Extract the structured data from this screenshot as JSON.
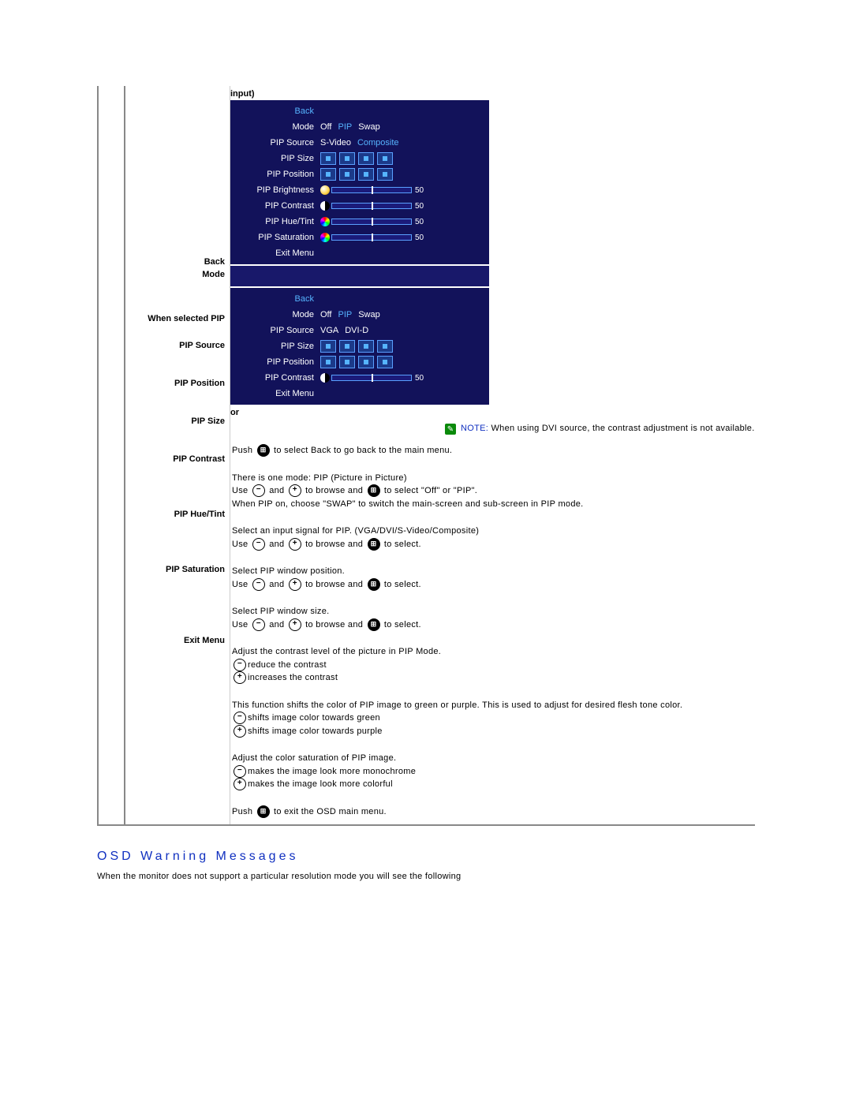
{
  "labels": {
    "input": "input)",
    "back": "Back",
    "mode": "Mode",
    "when_selected_pip": "When selected PIP",
    "pip_source": "PIP Source",
    "pip_position": "PIP Position",
    "pip_size": "PIP Size",
    "pip_contrast": "PIP Contrast",
    "pip_hue_tint": "PIP Hue/Tint",
    "pip_saturation": "PIP Saturation",
    "exit_menu": "Exit Menu",
    "or": "or"
  },
  "osd1": {
    "back": "Back",
    "mode": {
      "label": "Mode",
      "opts": [
        "Off",
        "PIP",
        "Swap"
      ]
    },
    "pip_source": {
      "label": "PIP Source",
      "opts": [
        "S-Video",
        "Composite"
      ]
    },
    "pip_size": {
      "label": "PIP Size"
    },
    "pip_position": {
      "label": "PIP Position"
    },
    "pip_brightness": {
      "label": "PIP Brightness",
      "value": "50"
    },
    "pip_contrast": {
      "label": "PIP Contrast",
      "value": "50"
    },
    "pip_hue_tint": {
      "label": "PIP Hue/Tint",
      "value": "50"
    },
    "pip_saturation": {
      "label": "PIP Saturation",
      "value": "50"
    },
    "exit": "Exit Menu"
  },
  "osd2": {
    "back": "Back",
    "mode": {
      "label": "Mode",
      "opts": [
        "Off",
        "PIP",
        "Swap"
      ]
    },
    "pip_source": {
      "label": "PIP Source",
      "opts": [
        "VGA",
        "DVI-D"
      ]
    },
    "pip_size": {
      "label": "PIP Size"
    },
    "pip_position": {
      "label": "PIP Position"
    },
    "pip_contrast": {
      "label": "PIP Contrast",
      "value": "50"
    },
    "exit": "Exit Menu"
  },
  "note": {
    "lead": "NOTE:",
    "text": "When using DVI source, the contrast adjustment is not available."
  },
  "desc": {
    "back1": "Push ",
    "back2": " to select Back to go back to the main menu.",
    "mode1": "There is one mode: PIP (Picture in Picture)",
    "mode2a": "Use ",
    "mode2b": " and ",
    "mode2c": " to browse and ",
    "mode2d": " to select \"Off\" or \"PIP\".",
    "mode3": "When PIP on, choose \"SWAP\" to switch the main-screen and sub-screen in PIP mode.",
    "source1": "Select an input signal for PIP. (VGA/DVI/S-Video/Composite)",
    "browse_a": "Use ",
    "browse_b": " and ",
    "browse_c": " to browse and ",
    "browse_d": " to select.",
    "position1": "Select PIP window position.",
    "size1": "Select PIP window size.",
    "contrast1": "Adjust the contrast level of the picture in PIP Mode.",
    "contrast2": "reduce the contrast",
    "contrast3": "increases the contrast",
    "hue1": "This function shifts the color of PIP image to green or purple. This is used to adjust for desired flesh tone color.",
    "hue2": "shifts image color towards green",
    "hue3": "shifts image color towards purple",
    "sat1": "Adjust the color saturation of PIP image.",
    "sat2": "makes the image look more monochrome",
    "sat3": "makes the image look more colorful",
    "exit1": "Push ",
    "exit2": " to exit the OSD main menu."
  },
  "section": {
    "title": "OSD Warning Messages",
    "body": "When the monitor does not support a particular resolution mode you will see the following"
  }
}
